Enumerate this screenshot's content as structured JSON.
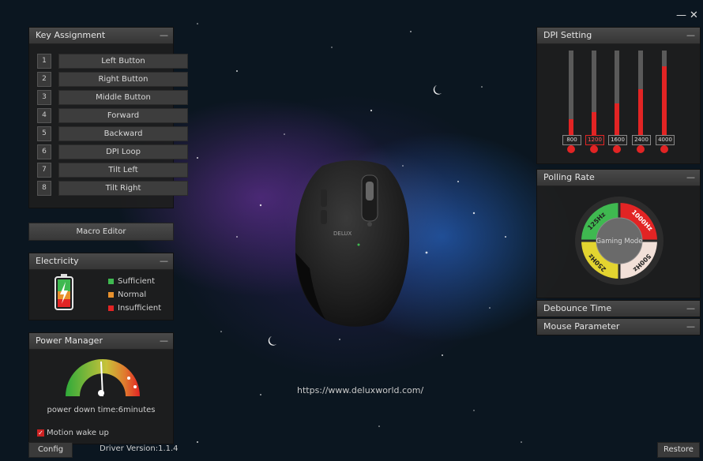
{
  "window": {
    "minimize_glyph": "—",
    "close_glyph": "✕"
  },
  "key_assignment": {
    "title": "Key Assignment",
    "collapse_glyph": "—",
    "keys": [
      {
        "num": "1",
        "label": "Left Button"
      },
      {
        "num": "2",
        "label": "Right Button"
      },
      {
        "num": "3",
        "label": "Middle Button"
      },
      {
        "num": "4",
        "label": "Forward"
      },
      {
        "num": "5",
        "label": "Backward"
      },
      {
        "num": "6",
        "label": "DPI Loop"
      },
      {
        "num": "7",
        "label": "Tilt Left"
      },
      {
        "num": "8",
        "label": "Tilt Right"
      }
    ]
  },
  "macro_editor": {
    "label": "Macro Editor"
  },
  "electricity": {
    "title": "Electricity",
    "collapse_glyph": "—",
    "legend": [
      {
        "label": "Sufficient",
        "color": "#3fb950"
      },
      {
        "label": "Normal",
        "color": "#e8912d"
      },
      {
        "label": "Insufficient",
        "color": "#e22424"
      }
    ]
  },
  "power_manager": {
    "title": "Power Manager",
    "collapse_glyph": "—",
    "status": "power down time:6minutes",
    "motion_wake_label": "Motion wake up",
    "motion_wake_checked": true
  },
  "footer": {
    "config_label": "Config",
    "driver_version": "Driver Version:1.1.4",
    "restore_label": "Restore"
  },
  "url": "https://www.deluxworld.com/",
  "dpi": {
    "title": "DPI Setting",
    "collapse_glyph": "—",
    "levels": [
      {
        "label": "800",
        "fill": 0.22
      },
      {
        "label": "1200",
        "fill": 0.3
      },
      {
        "label": "1600",
        "fill": 0.4
      },
      {
        "label": "2400",
        "fill": 0.56
      },
      {
        "label": "4000",
        "fill": 0.82
      }
    ],
    "accent": "#e22424"
  },
  "polling": {
    "title": "Polling Rate",
    "collapse_glyph": "—",
    "center": "Gaming Mode",
    "rates": [
      "125Hz",
      "1000Hz",
      "500Hz",
      "250Hz"
    ]
  },
  "debounce": {
    "title": "Debounce Time",
    "collapse_glyph": "—"
  },
  "mouse_param": {
    "title": "Mouse Parameter",
    "collapse_glyph": "—"
  },
  "mouse_brand": "DELUX"
}
